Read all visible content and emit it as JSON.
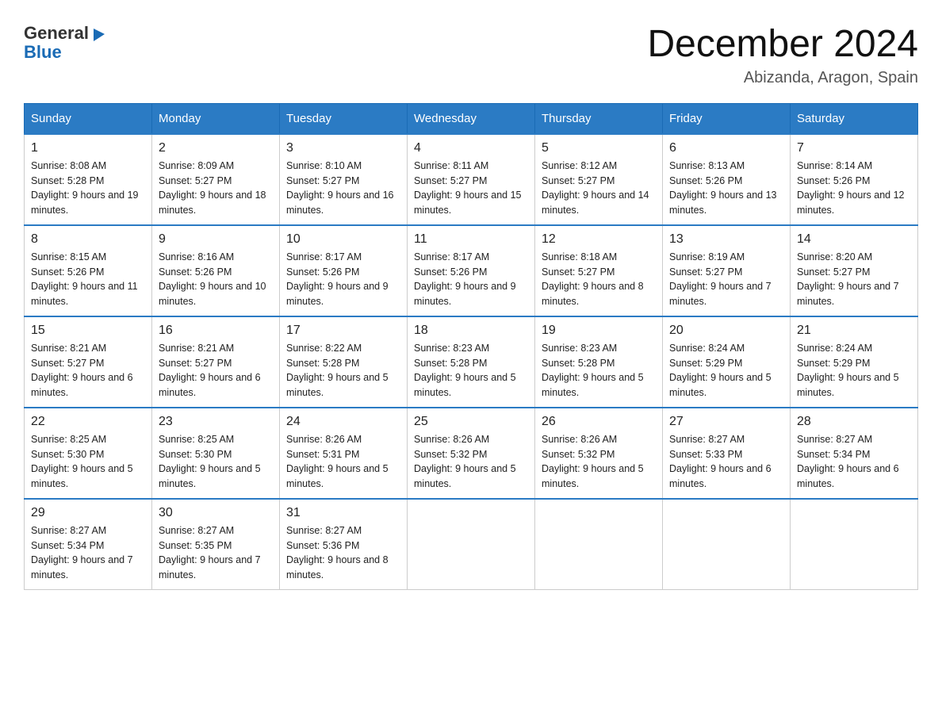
{
  "header": {
    "logo_general": "General",
    "logo_arrow": "▶",
    "logo_blue": "Blue",
    "title": "December 2024",
    "subtitle": "Abizanda, Aragon, Spain"
  },
  "days_of_week": [
    "Sunday",
    "Monday",
    "Tuesday",
    "Wednesday",
    "Thursday",
    "Friday",
    "Saturday"
  ],
  "weeks": [
    [
      {
        "date": "1",
        "sunrise": "8:08 AM",
        "sunset": "5:28 PM",
        "daylight": "9 hours and 19 minutes."
      },
      {
        "date": "2",
        "sunrise": "8:09 AM",
        "sunset": "5:27 PM",
        "daylight": "9 hours and 18 minutes."
      },
      {
        "date": "3",
        "sunrise": "8:10 AM",
        "sunset": "5:27 PM",
        "daylight": "9 hours and 16 minutes."
      },
      {
        "date": "4",
        "sunrise": "8:11 AM",
        "sunset": "5:27 PM",
        "daylight": "9 hours and 15 minutes."
      },
      {
        "date": "5",
        "sunrise": "8:12 AM",
        "sunset": "5:27 PM",
        "daylight": "9 hours and 14 minutes."
      },
      {
        "date": "6",
        "sunrise": "8:13 AM",
        "sunset": "5:26 PM",
        "daylight": "9 hours and 13 minutes."
      },
      {
        "date": "7",
        "sunrise": "8:14 AM",
        "sunset": "5:26 PM",
        "daylight": "9 hours and 12 minutes."
      }
    ],
    [
      {
        "date": "8",
        "sunrise": "8:15 AM",
        "sunset": "5:26 PM",
        "daylight": "9 hours and 11 minutes."
      },
      {
        "date": "9",
        "sunrise": "8:16 AM",
        "sunset": "5:26 PM",
        "daylight": "9 hours and 10 minutes."
      },
      {
        "date": "10",
        "sunrise": "8:17 AM",
        "sunset": "5:26 PM",
        "daylight": "9 hours and 9 minutes."
      },
      {
        "date": "11",
        "sunrise": "8:17 AM",
        "sunset": "5:26 PM",
        "daylight": "9 hours and 9 minutes."
      },
      {
        "date": "12",
        "sunrise": "8:18 AM",
        "sunset": "5:27 PM",
        "daylight": "9 hours and 8 minutes."
      },
      {
        "date": "13",
        "sunrise": "8:19 AM",
        "sunset": "5:27 PM",
        "daylight": "9 hours and 7 minutes."
      },
      {
        "date": "14",
        "sunrise": "8:20 AM",
        "sunset": "5:27 PM",
        "daylight": "9 hours and 7 minutes."
      }
    ],
    [
      {
        "date": "15",
        "sunrise": "8:21 AM",
        "sunset": "5:27 PM",
        "daylight": "9 hours and 6 minutes."
      },
      {
        "date": "16",
        "sunrise": "8:21 AM",
        "sunset": "5:27 PM",
        "daylight": "9 hours and 6 minutes."
      },
      {
        "date": "17",
        "sunrise": "8:22 AM",
        "sunset": "5:28 PM",
        "daylight": "9 hours and 5 minutes."
      },
      {
        "date": "18",
        "sunrise": "8:23 AM",
        "sunset": "5:28 PM",
        "daylight": "9 hours and 5 minutes."
      },
      {
        "date": "19",
        "sunrise": "8:23 AM",
        "sunset": "5:28 PM",
        "daylight": "9 hours and 5 minutes."
      },
      {
        "date": "20",
        "sunrise": "8:24 AM",
        "sunset": "5:29 PM",
        "daylight": "9 hours and 5 minutes."
      },
      {
        "date": "21",
        "sunrise": "8:24 AM",
        "sunset": "5:29 PM",
        "daylight": "9 hours and 5 minutes."
      }
    ],
    [
      {
        "date": "22",
        "sunrise": "8:25 AM",
        "sunset": "5:30 PM",
        "daylight": "9 hours and 5 minutes."
      },
      {
        "date": "23",
        "sunrise": "8:25 AM",
        "sunset": "5:30 PM",
        "daylight": "9 hours and 5 minutes."
      },
      {
        "date": "24",
        "sunrise": "8:26 AM",
        "sunset": "5:31 PM",
        "daylight": "9 hours and 5 minutes."
      },
      {
        "date": "25",
        "sunrise": "8:26 AM",
        "sunset": "5:32 PM",
        "daylight": "9 hours and 5 minutes."
      },
      {
        "date": "26",
        "sunrise": "8:26 AM",
        "sunset": "5:32 PM",
        "daylight": "9 hours and 5 minutes."
      },
      {
        "date": "27",
        "sunrise": "8:27 AM",
        "sunset": "5:33 PM",
        "daylight": "9 hours and 6 minutes."
      },
      {
        "date": "28",
        "sunrise": "8:27 AM",
        "sunset": "5:34 PM",
        "daylight": "9 hours and 6 minutes."
      }
    ],
    [
      {
        "date": "29",
        "sunrise": "8:27 AM",
        "sunset": "5:34 PM",
        "daylight": "9 hours and 7 minutes."
      },
      {
        "date": "30",
        "sunrise": "8:27 AM",
        "sunset": "5:35 PM",
        "daylight": "9 hours and 7 minutes."
      },
      {
        "date": "31",
        "sunrise": "8:27 AM",
        "sunset": "5:36 PM",
        "daylight": "9 hours and 8 minutes."
      },
      null,
      null,
      null,
      null
    ]
  ]
}
